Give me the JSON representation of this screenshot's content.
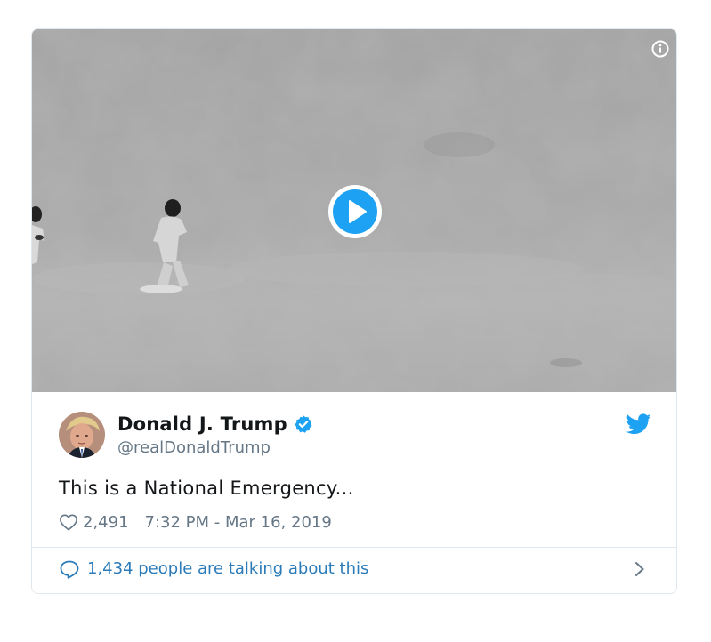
{
  "tweet": {
    "author": {
      "display_name": "Donald J. Trump",
      "screen_name": "@realDonaldTrump",
      "verified": true,
      "avatar_icon": "avatar-photo"
    },
    "text": "This is a National Emergency...",
    "likes": "2,491",
    "timestamp": "7:32 PM - Mar 16, 2019",
    "talking": "1,434 people are talking about this"
  },
  "media": {
    "type": "video",
    "play_icon": "play-icon",
    "info_icon": "info-icon"
  },
  "icons": {
    "brand": "twitter-bird-icon",
    "verified": "verified-badge-icon",
    "like": "heart-icon",
    "reply": "reply-bubble-icon",
    "more": "chevron-right-icon"
  },
  "colors": {
    "brand_blue": "#1da1f2",
    "link_blue": "#2b7bb9",
    "text_primary": "#14171a",
    "text_secondary": "#657786",
    "border": "#e1e8ed"
  }
}
